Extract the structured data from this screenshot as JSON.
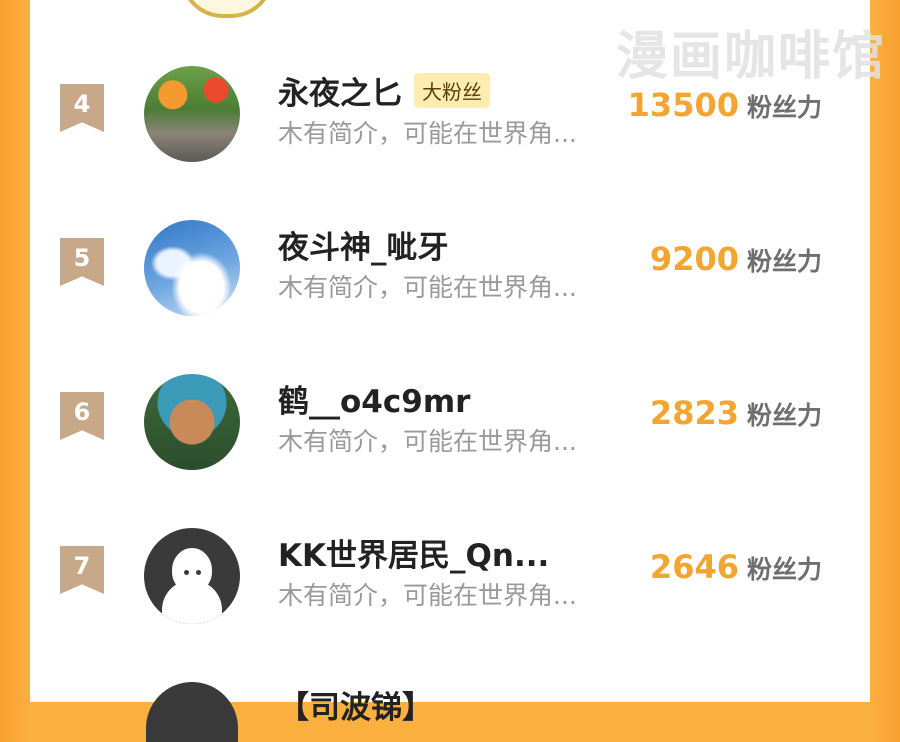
{
  "watermark": "漫画咖啡馆",
  "rows": [
    {
      "rank": "4",
      "name": "永夜之匕",
      "badge": "大粉丝",
      "bio": "木有简介，可能在世界角...",
      "score": "13500",
      "unit": "粉丝力"
    },
    {
      "rank": "5",
      "name": "夜斗神_呲牙",
      "bio": "木有简介，可能在世界角...",
      "score": "9200",
      "unit": "粉丝力"
    },
    {
      "rank": "6",
      "name": "鹤__o4c9mr",
      "bio": "木有简介，可能在世界角...",
      "score": "2823",
      "unit": "粉丝力"
    },
    {
      "rank": "7",
      "name": "KK世界居民_Qn...",
      "bio": "木有简介，可能在世界角...",
      "score": "2646",
      "unit": "粉丝力"
    }
  ],
  "partial_row": {
    "name": "【司波锑】"
  },
  "colors": {
    "accent": "#f2a530",
    "frame": "#fbb040",
    "rank_badge": "#c7a889",
    "fan_badge_bg": "#fdeeb0"
  }
}
